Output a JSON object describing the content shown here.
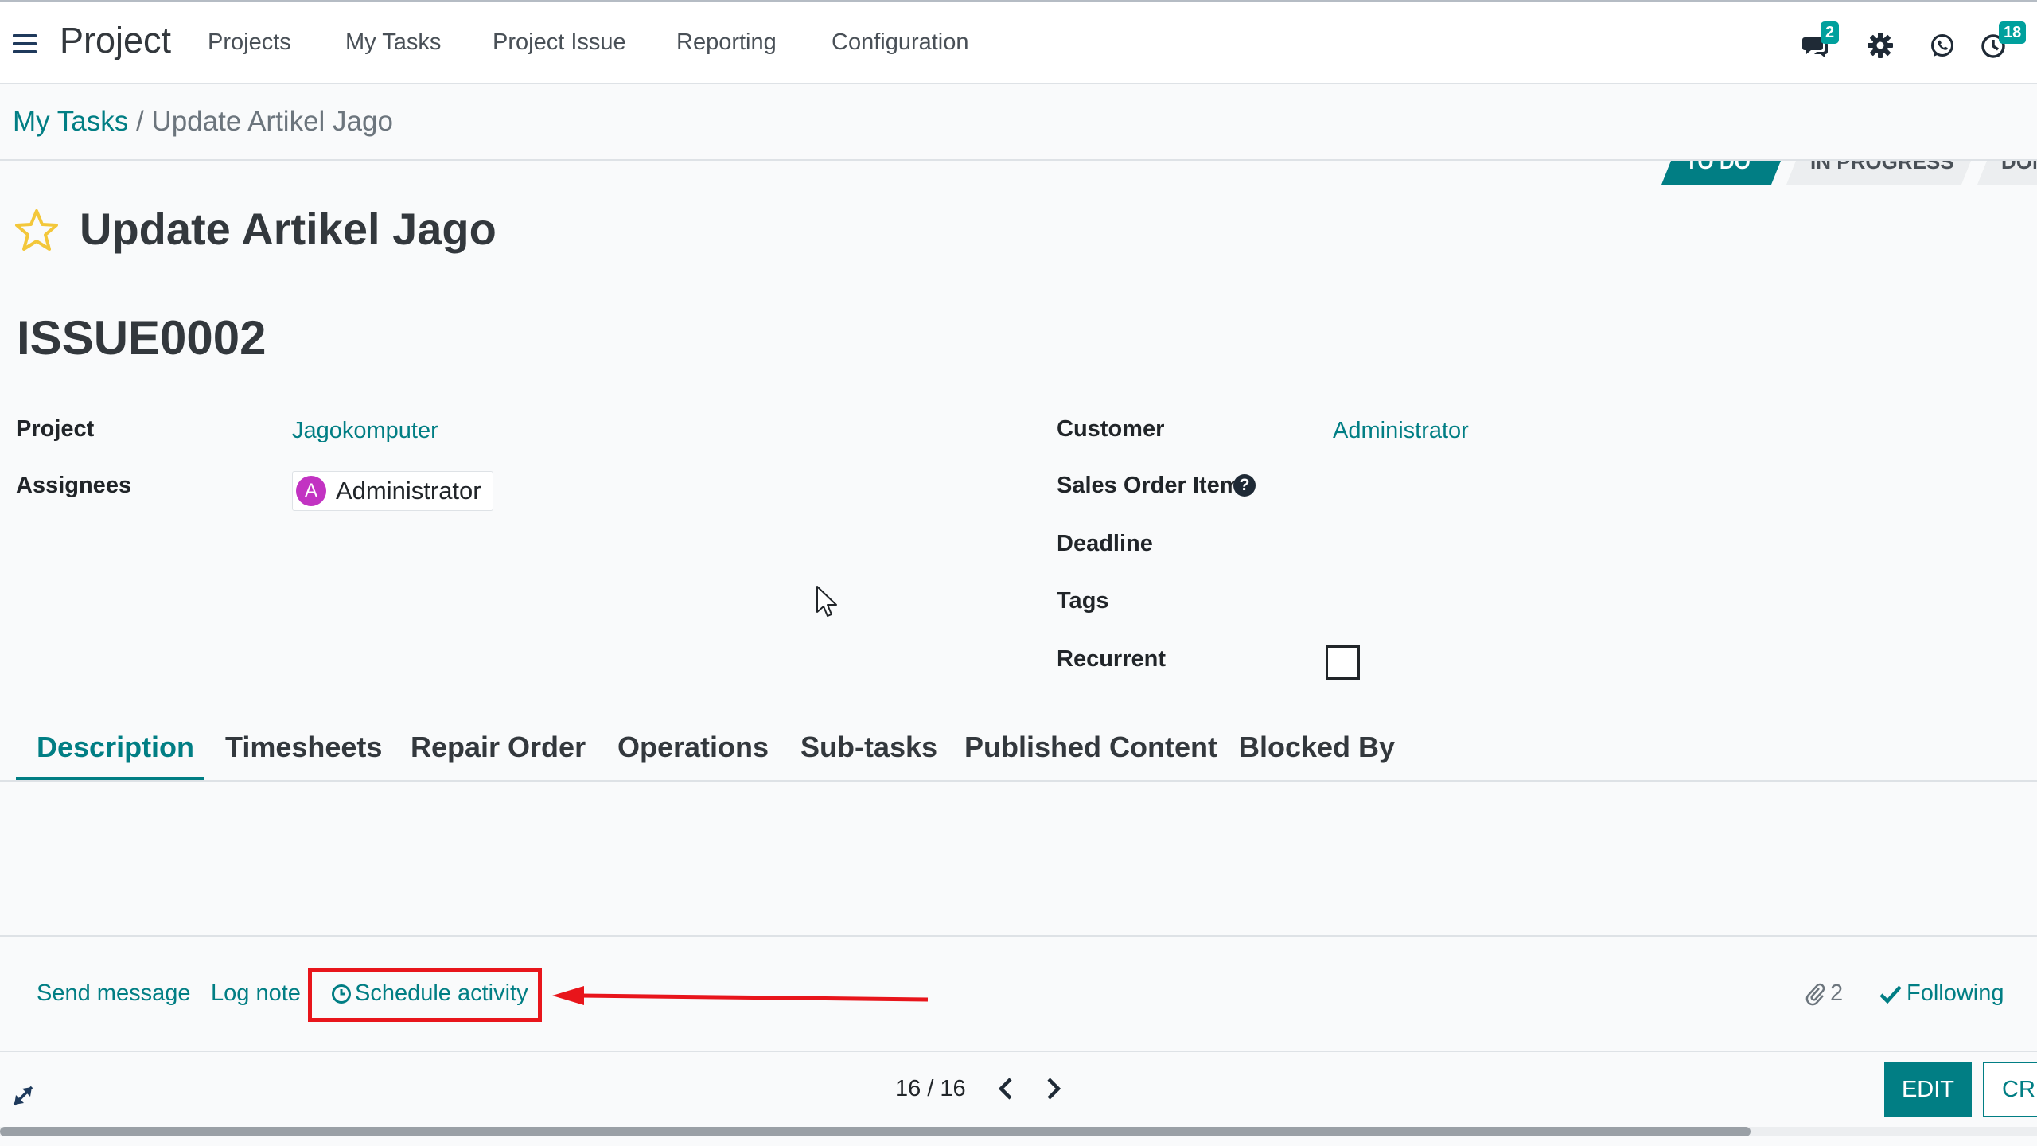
{
  "navbar": {
    "app_title": "Project",
    "menu": [
      "Projects",
      "My Tasks",
      "Project Issue",
      "Reporting",
      "Configuration"
    ],
    "messages_badge": "2",
    "activities_badge": "18"
  },
  "breadcrumb": {
    "parent": "My Tasks",
    "separator": "/",
    "current": "Update Artikel Jago"
  },
  "statusbar": {
    "stages": [
      "TO DO",
      "IN PROGRESS",
      "DONE"
    ],
    "active_stage": "TO DO"
  },
  "task": {
    "title": "Update Artikel Jago",
    "issue_number": "ISSUE0002"
  },
  "fields": {
    "project_label": "Project",
    "project_value": "Jagokomputer",
    "assignees_label": "Assignees",
    "assignee_initial": "A",
    "assignee_name": "Administrator",
    "customer_label": "Customer",
    "customer_value": "Administrator",
    "sales_order_item_label": "Sales Order Item",
    "deadline_label": "Deadline",
    "tags_label": "Tags",
    "recurrent_label": "Recurrent"
  },
  "tabs": [
    "Description",
    "Timesheets",
    "Repair Order",
    "Operations",
    "Sub-tasks",
    "Published Content",
    "Blocked By"
  ],
  "chatter": {
    "send_message": "Send message",
    "log_note": "Log note",
    "schedule_activity": "Schedule activity",
    "attachments_count": "2",
    "following": "Following"
  },
  "pager": {
    "value": "16 / 16"
  },
  "buttons": {
    "edit": "EDIT",
    "create": "CREATE"
  },
  "colors": {
    "accent": "#017e84",
    "badge": "#00a09d",
    "highlight_box": "#e8151b",
    "star": "#f3c73a",
    "avatar": "#c233c2"
  }
}
